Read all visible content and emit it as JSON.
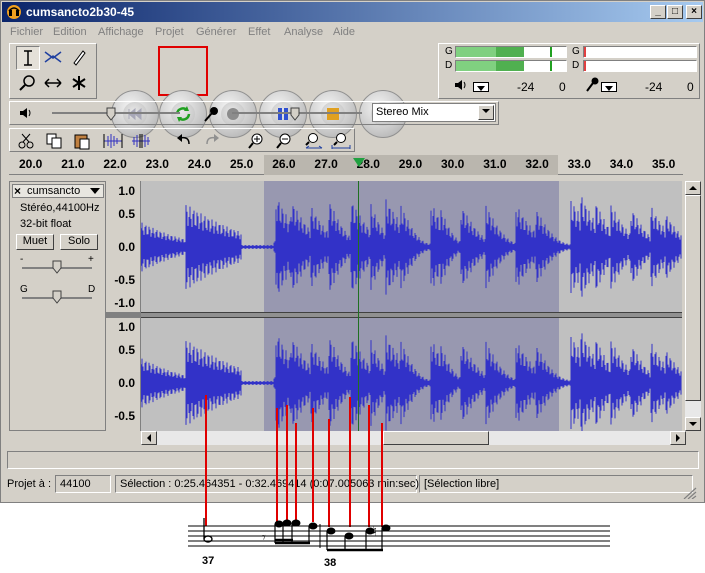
{
  "window": {
    "title": "cumsancto2b30-45",
    "min_label": "_",
    "max_label": "□",
    "close_label": "×"
  },
  "menu": [
    "Fichier",
    "Edition",
    "Affichage",
    "Projet",
    "Générer",
    "Effet",
    "Analyse",
    "Aide"
  ],
  "meters": {
    "left_label": "G",
    "right_label": "D",
    "play_ticks": [
      "-24",
      "0"
    ],
    "rec_ticks": [
      "-24",
      "0"
    ]
  },
  "mixer": {
    "input_source": "Stereo Mix"
  },
  "ruler": {
    "ticks": [
      "20.0",
      "21.0",
      "22.0",
      "23.0",
      "24.0",
      "25.0",
      "26.0",
      "27.0",
      "28.0",
      "29.0",
      "30.0",
      "31.0",
      "32.0",
      "33.0",
      "34.0",
      "35.0"
    ]
  },
  "track": {
    "name": "cumsancto",
    "info_rate": "Stéréo,44100Hz",
    "info_format": "32-bit float",
    "mute_label": "Muet",
    "solo_label": "Solo",
    "pan_left": "G",
    "pan_right": "D",
    "gain_minus": "-",
    "gain_plus": "+",
    "scale_top": [
      "1.0",
      "0.5",
      "0.0",
      "-0.5",
      "-1.0"
    ],
    "scale_bottom": [
      "1.0",
      "0.5",
      "0.0",
      "-0.5"
    ]
  },
  "status": {
    "project_label": "Projet à :",
    "project_rate": "44100",
    "selection": "Sélection : 0:25.464351 - 0:32.469414 (0:07.005063 min:sec)",
    "mode": "[Sélection libre]"
  },
  "score": {
    "measure_a": "37",
    "measure_b": "38"
  },
  "colors": {
    "waveform": "#3232c8",
    "selection": "#9898b0",
    "highlight": "#e00000"
  }
}
